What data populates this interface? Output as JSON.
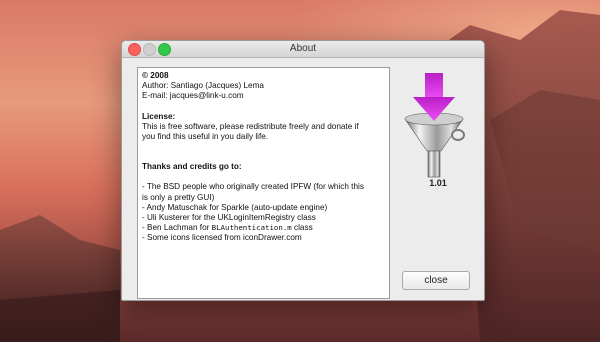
{
  "window": {
    "title": "About",
    "close_label": "close",
    "version": "1.01"
  },
  "about_text": {
    "copyright": "© 2008",
    "author": "Author: Santiago (Jacques) Lema",
    "email": "E-mail: jacques@link-u.com",
    "license_heading": "License:",
    "license_line1": "This is free software, please redistribute freely and donate if",
    "license_line2": "you find this useful in you daily life.",
    "credits_heading": "Thanks and credits go to:",
    "credit1_line1": "- The BSD people who originally created IPFW (for which this",
    "credit1_line2": "is only a pretty GUI)",
    "credit2": "- Andy Matuschak for Sparkle (auto-update engine)",
    "credit3": "- Uli Kusterer for the UKLoginItemRegistry class",
    "credit4_prefix": "- Ben Lachman for ",
    "credit4_code": "BLAuthentication.m",
    "credit4_suffix": " class",
    "credit5": "- Some icons licensed from iconDrawer.com"
  },
  "icons": {
    "app": "funnel-icon"
  },
  "colors": {
    "close_button_red": "#fc605c",
    "zoom_button_green": "#34c84a",
    "arrow_magenta": "#d62ee0"
  }
}
